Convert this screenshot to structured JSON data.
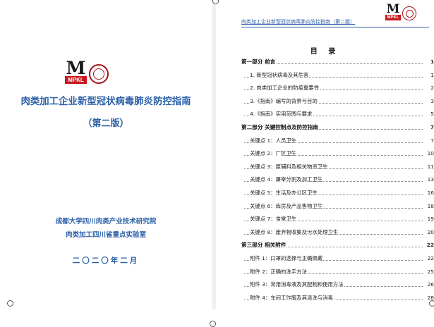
{
  "cover": {
    "logo_letter": "M",
    "logo_text": "MPKL",
    "title": "肉类加工企业新型冠状病毒肺炎防控指南",
    "edition": "（第二版）",
    "org_line1": "成都大学四川肉类产业技术研究院",
    "org_line2": "肉类加工四川省重点实验室",
    "date": "二〇二〇年二月"
  },
  "toc": {
    "header": "肉类加工企业新型冠状病毒肺炎防控指南（第二版）",
    "logo_letter": "M",
    "logo_text": "MPKL",
    "title": "目  录",
    "rows": [
      {
        "label": "第一部分  前言",
        "page": "1",
        "part": true
      },
      {
        "label": "1. 新型冠状病毒及其危害",
        "page": "1",
        "part": false
      },
      {
        "label": "2. 肉类加工企业的防疫重要性",
        "page": "2",
        "part": false
      },
      {
        "label": "3.《指南》编写的背景与目的",
        "page": "3",
        "part": false
      },
      {
        "label": "4.《指南》实用范围与要求",
        "page": "5",
        "part": false
      },
      {
        "label": "第二部分  关键控制点及防控指南",
        "page": "7",
        "part": true
      },
      {
        "label": "关键点 1：人员卫生",
        "page": "7",
        "part": false
      },
      {
        "label": "关键点 2：厂区卫生",
        "page": "10",
        "part": false
      },
      {
        "label": "关键点 3：原辅料及相关物资卫生",
        "page": "11",
        "part": false
      },
      {
        "label": "关键点 4：屠宰分割及加工卫生",
        "page": "13",
        "part": false
      },
      {
        "label": "关键点 5：生活及办公区卫生",
        "page": "16",
        "part": false
      },
      {
        "label": "关键点 6：库房及产品售物卫生",
        "page": "18",
        "part": false
      },
      {
        "label": "关键点 7：食堂卫生",
        "page": "19",
        "part": false
      },
      {
        "label": "关键点 8：废弃物收集及污水处理卫生",
        "page": "20",
        "part": false
      },
      {
        "label": "第三部分  相关附件",
        "page": "22",
        "part": true
      },
      {
        "label": "附件 1：口罩的选择与正确佩戴",
        "page": "22",
        "part": false
      },
      {
        "label": "附件 2：正确的洗手方法",
        "page": "25",
        "part": false
      },
      {
        "label": "附件 3：常用消毒液及其配制和使用方法",
        "page": "26",
        "part": false
      },
      {
        "label": "附件 4：车间工作服及其清洗与消毒",
        "page": "28",
        "part": false
      }
    ]
  },
  "colors": {
    "title_blue": "#2a5fa8",
    "logo_red": "#c8181f",
    "seal_red": "#a5161c"
  }
}
